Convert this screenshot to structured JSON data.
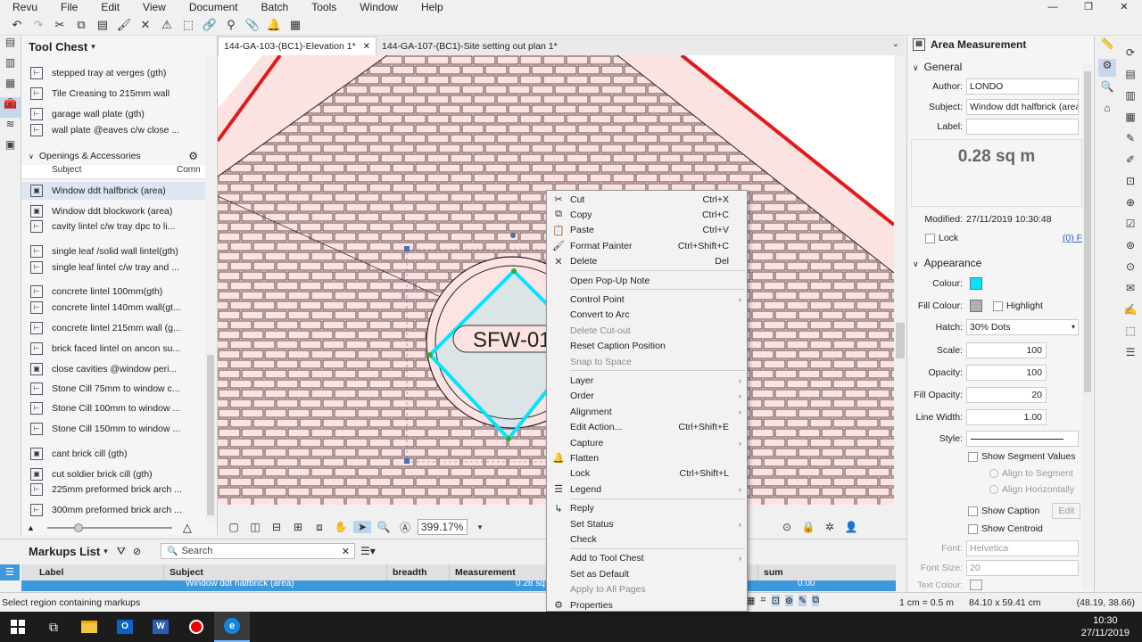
{
  "menubar": {
    "items": [
      "Revu",
      "File",
      "Edit",
      "View",
      "Document",
      "Batch",
      "Tools",
      "Window",
      "Help"
    ]
  },
  "toolchest": {
    "title": "Tool Chest",
    "items_top": [
      {
        "label": "stepped tray at verges (gth)",
        "icon": "lintel-icon"
      },
      {
        "label": "Tile Creasing to 215mm wall",
        "icon": "tile-icon"
      },
      {
        "label": "garage wall plate (gth)",
        "icon": "lintel-icon"
      },
      {
        "label": "wall plate @eaves c/w close ...",
        "icon": "lintel-icon"
      }
    ],
    "section": "Openings & Accessories",
    "columns": [
      "Subject",
      "Comn"
    ],
    "items": [
      {
        "label": "Window ddt  halfbrick (area)"
      },
      {
        "label": "Window ddt  blockwork (area)"
      },
      {
        "label": "cavity lintel c/w tray dpc to li..."
      },
      {
        "label": "single leaf /solid wall lintel(gth)"
      },
      {
        "label": "single leaf lintel c/w tray and ..."
      },
      {
        "label": "concrete lintel 100mm(gth)"
      },
      {
        "label": "concrete lintel 140mm wall(gt..."
      },
      {
        "label": "concrete lintel 215mm wall (g..."
      },
      {
        "label": "brick faced lintel on ancon su..."
      },
      {
        "label": "close cavities @window peri..."
      },
      {
        "label": "Stone Cill 75mm to window c..."
      },
      {
        "label": "Stone Cill 100mm to window ..."
      },
      {
        "label": "Stone Cill 150mm to window ..."
      },
      {
        "label": "cant brick cill (gth)"
      },
      {
        "label": "cut soldier brick cill (gth)"
      },
      {
        "label": "225mm preformed brick arch ..."
      },
      {
        "label": "300mm preformed brick arch ..."
      }
    ]
  },
  "tabs": [
    {
      "label": "144-GA-103-(BC1)-Elevation 1*",
      "close": "✕"
    },
    {
      "label": "144-GA-107-(BC1)-Site setting out plan 1*"
    }
  ],
  "canvas": {
    "caption": "SFW-01"
  },
  "viewbar": {
    "zoom": "399.17%"
  },
  "context_menu": [
    {
      "label": "Cut",
      "shortcut": "Ctrl+X",
      "icon": "scissors-icon",
      "glyph": "✂"
    },
    {
      "label": "Copy",
      "shortcut": "Ctrl+C",
      "icon": "copy-icon",
      "glyph": "⧉"
    },
    {
      "label": "Paste",
      "shortcut": "Ctrl+V",
      "icon": "paste-icon",
      "glyph": "📋"
    },
    {
      "label": "Format Painter",
      "shortcut": "Ctrl+Shift+C",
      "icon": "format-painter-icon",
      "glyph": "🖌"
    },
    {
      "label": "Delete",
      "shortcut": "Del",
      "icon": "delete-icon",
      "glyph": "✕"
    },
    {
      "sep": true
    },
    {
      "label": "Open Pop-Up Note"
    },
    {
      "sep": true
    },
    {
      "label": "Control Point",
      "submenu": true
    },
    {
      "label": "Convert to Arc"
    },
    {
      "label": "Delete Cut-out",
      "disabled": true
    },
    {
      "label": "Reset Caption Position"
    },
    {
      "label": "Snap to Space",
      "disabled": true
    },
    {
      "sep": true
    },
    {
      "label": "Layer",
      "submenu": true
    },
    {
      "label": "Order",
      "submenu": true
    },
    {
      "label": "Alignment",
      "submenu": true
    },
    {
      "label": "Edit Action...",
      "shortcut": "Ctrl+Shift+E"
    },
    {
      "label": "Capture",
      "submenu": true
    },
    {
      "label": "Flatten",
      "icon": "flatten-icon",
      "glyph": "🔔"
    },
    {
      "label": "Lock",
      "shortcut": "Ctrl+Shift+L"
    },
    {
      "label": "Legend",
      "submenu": true,
      "icon": "legend-icon",
      "glyph": "☰"
    },
    {
      "sep": true
    },
    {
      "label": "Reply",
      "icon": "reply-icon",
      "glyph": "↳"
    },
    {
      "label": "Set Status",
      "submenu": true
    },
    {
      "label": "Check"
    },
    {
      "sep": true
    },
    {
      "label": "Add to Tool Chest",
      "submenu": true
    },
    {
      "label": "Set as Default"
    },
    {
      "label": "Apply to All Pages",
      "disabled": true
    },
    {
      "label": "Properties",
      "icon": "gear-icon",
      "glyph": "⚙"
    }
  ],
  "properties": {
    "title": "Area Measurement",
    "general": "General",
    "author_label": "Author:",
    "author": "LONDO",
    "subject_label": "Subject:",
    "subject": "Window ddt  halfbrick (area)",
    "label_label": "Label:",
    "measurement": "0.28 sq m",
    "modified_label": "Modified:",
    "modified": "27/11/2019 10:30:48",
    "lock": "Lock",
    "lock_link": "(0) F",
    "appearance": "Appearance",
    "colour_label": "Colour:",
    "colour": "#00e5ff",
    "fill_colour_label": "Fill Colour:",
    "fill_colour": "#b0b0b0",
    "highlight": "Highlight",
    "hatch_label": "Hatch:",
    "hatch": "30% Dots",
    "scale_label": "Scale:",
    "scale": "100",
    "opacity_label": "Opacity:",
    "opacity": "100",
    "fill_opacity_label": "Fill Opacity:",
    "fill_opacity": "20",
    "line_width_label": "Line Width:",
    "line_width": "1.00",
    "style_label": "Style:",
    "show_segment_values": "Show Segment Values",
    "align_to_segment": "Align to Segment",
    "align_horizontally": "Align Horizontally",
    "show_caption": "Show Caption",
    "edit": "Edit",
    "show_centroid": "Show Centroid",
    "font_label": "Font:",
    "font": "Helvetica",
    "font_size_label": "Font Size:",
    "font_size": "20",
    "text_colour_label": "Text Colour:"
  },
  "markups": {
    "title": "Markups List",
    "search_placeholder": "Search",
    "columns": [
      "Label",
      "Subject",
      "breadth",
      "Measurement",
      "sum"
    ],
    "row": {
      "subject": "Window ddt  halfbrick (area)",
      "measurement": "0.28 sq",
      "sum": "0.00"
    }
  },
  "status": {
    "left": "Select region containing markups",
    "scale": "1 cm = 0.5 m",
    "size": "84.10 x 59.41 cm",
    "coords": "(48.19, 38.66)"
  },
  "taskbar": {
    "time": "10:30",
    "date": "27/11/2019"
  }
}
